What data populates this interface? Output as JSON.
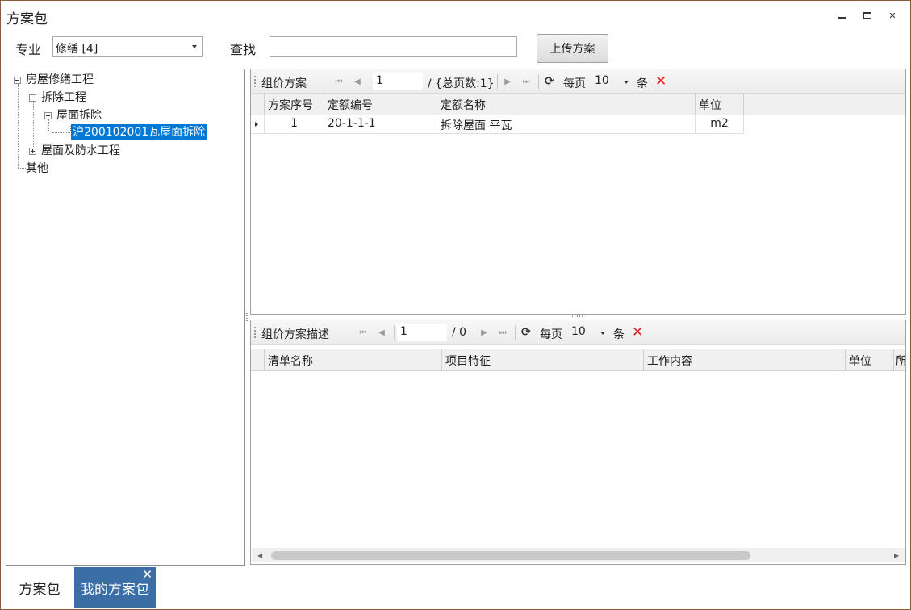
{
  "window": {
    "title": "方案包"
  },
  "toolbar": {
    "specialty_label": "专业",
    "specialty_value": "修缮 [4]",
    "search_label": "查找",
    "search_value": "",
    "upload_label": "上传方案"
  },
  "tree": {
    "root": "房屋修缮工程",
    "child1": "拆除工程",
    "child1_1": "屋面拆除",
    "child1_1_1": "沪200102001瓦屋面拆除",
    "child2": "屋面及防水工程",
    "other": "其他"
  },
  "top_panel": {
    "title": "组价方案",
    "page_value": "1",
    "total_text": "/ {总页数:1}",
    "per_page_label": "每页",
    "per_page_value": "10",
    "unit_label": "条",
    "columns": [
      "方案序号",
      "定额编号",
      "定额名称",
      "单位"
    ],
    "rows": [
      [
        "1",
        "20-1-1-1",
        "拆除屋面 平瓦",
        "m2"
      ]
    ]
  },
  "bottom_panel": {
    "title": "组价方案描述",
    "page_value": "1",
    "total_text": "/ 0",
    "per_page_label": "每页",
    "per_page_value": "10",
    "unit_label": "条",
    "columns": [
      "清单名称",
      "项目特征",
      "工作内容",
      "单位",
      "所"
    ]
  },
  "tabs": [
    {
      "label": "方案包"
    },
    {
      "label": "我的方案包"
    }
  ],
  "colors": {
    "selected_bg": "#0078d7",
    "active_tab_bg": "#3a6ea5",
    "delete_red": "#e02020",
    "window_border": "#8a5a3c"
  }
}
